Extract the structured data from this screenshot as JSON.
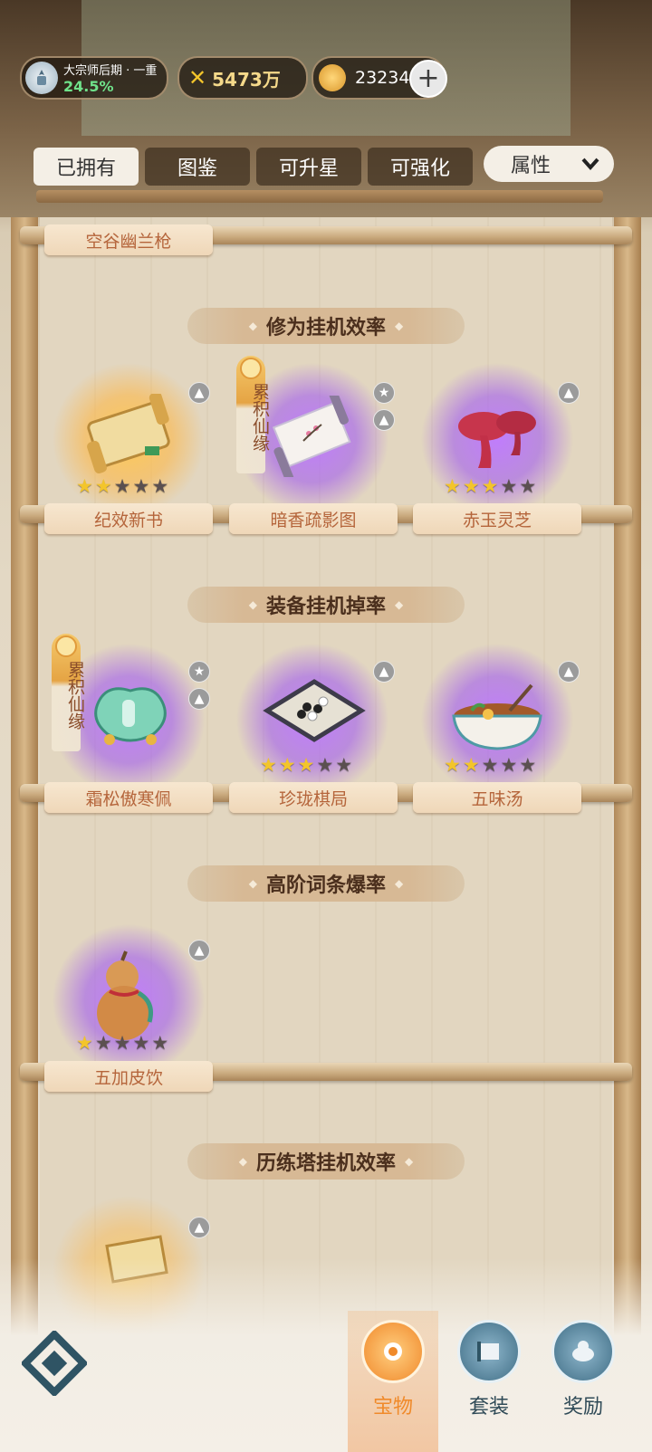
{
  "header": {
    "rank_title": "大宗师后期 · 一重",
    "rank_progress": "24.5%",
    "power_value": "5473万",
    "currency_value": "23234"
  },
  "tabs": [
    {
      "label": "已拥有",
      "active": true
    },
    {
      "label": "图鉴",
      "active": false
    },
    {
      "label": "可升星",
      "active": false
    },
    {
      "label": "可强化",
      "active": false
    }
  ],
  "filter": {
    "label": "属性"
  },
  "top_partial_item": {
    "name": "空谷幽兰枪"
  },
  "badge_text": "累积仙缘",
  "sections": [
    {
      "title": "修为挂机效率",
      "items": [
        {
          "name": "纪效新书",
          "stars": 2,
          "max_stars": 5,
          "rarity": "gold",
          "badge": false,
          "icons": [
            "upgrade-icon"
          ]
        },
        {
          "name": "暗香疏影图",
          "stars": 0,
          "max_stars": 5,
          "rarity": "purple",
          "badge": true,
          "icons": [
            "star-upgrade-icon",
            "upgrade-icon"
          ]
        },
        {
          "name": "赤玉灵芝",
          "stars": 3,
          "max_stars": 5,
          "rarity": "purple",
          "badge": false,
          "icons": [
            "upgrade-icon"
          ]
        }
      ]
    },
    {
      "title": "装备挂机掉率",
      "items": [
        {
          "name": "霜松傲寒佩",
          "stars": 0,
          "max_stars": 5,
          "rarity": "purple",
          "badge": true,
          "icons": [
            "star-upgrade-icon",
            "upgrade-icon"
          ]
        },
        {
          "name": "珍珑棋局",
          "stars": 3,
          "max_stars": 5,
          "rarity": "purple",
          "badge": false,
          "icons": [
            "upgrade-icon"
          ]
        },
        {
          "name": "五味汤",
          "stars": 2,
          "max_stars": 5,
          "rarity": "purple",
          "badge": false,
          "icons": [
            "upgrade-icon"
          ]
        }
      ]
    },
    {
      "title": "高阶词条爆率",
      "items": [
        {
          "name": "五加皮饮",
          "stars": 1,
          "max_stars": 5,
          "rarity": "purple",
          "badge": false,
          "icons": [
            "upgrade-icon"
          ]
        }
      ]
    },
    {
      "title": "历练塔挂机效率",
      "items": []
    }
  ],
  "bottom_nav": [
    {
      "label": "宝物",
      "active": true,
      "icon": "treasure-icon"
    },
    {
      "label": "套装",
      "active": false,
      "icon": "set-scroll-icon"
    },
    {
      "label": "奖励",
      "active": false,
      "icon": "reward-icon"
    }
  ],
  "colors": {
    "accent_orange": "#f08a2a",
    "label_text": "#b5653b",
    "star_on": "#f3c52b",
    "progress_green": "#6fe28a"
  }
}
